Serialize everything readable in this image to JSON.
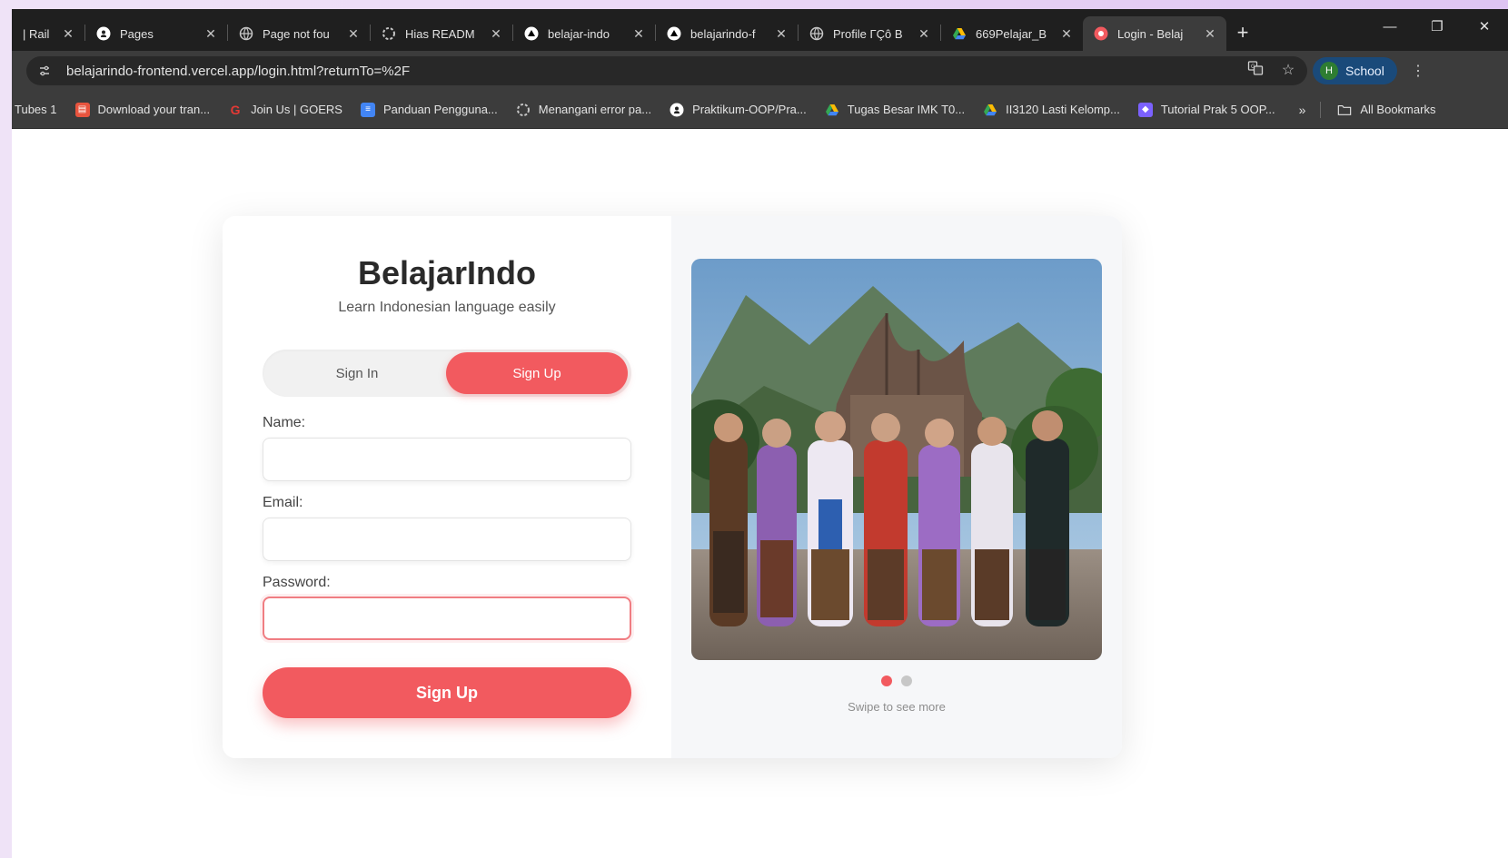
{
  "browser": {
    "tabs": [
      {
        "label": "| Rail",
        "favicon": "rails-icon",
        "color": "#8a8a8a"
      },
      {
        "label": "Pages",
        "favicon": "github-icon",
        "color": "#ffffff"
      },
      {
        "label": "Page not fou",
        "favicon": "globe-icon",
        "color": "#9e9e9e"
      },
      {
        "label": "Hias READM",
        "favicon": "openai-icon",
        "color": "#9e9e9e"
      },
      {
        "label": "belajar-indo",
        "favicon": "vercel-icon",
        "color": "#ffffff"
      },
      {
        "label": "belajarindo-f",
        "favicon": "vercel-icon",
        "color": "#ffffff"
      },
      {
        "label": "Profile ΓÇô B",
        "favicon": "globe-icon",
        "color": "#9e9e9e"
      },
      {
        "label": "669Pelajar_B",
        "favicon": "drive-icon",
        "color": "#34a853"
      },
      {
        "label": "Login - Belaj",
        "favicon": "belajarindo-icon",
        "color": "#f25a5f",
        "active": true
      }
    ],
    "url": "belajarindo-frontend.vercel.app/login.html?returnTo=%2F",
    "profile": {
      "initial": "H",
      "label": "School"
    },
    "bookmarks": [
      {
        "label": "Tubes 1",
        "icon": "",
        "color": ""
      },
      {
        "label": "Download your tran...",
        "icon": "document-icon",
        "color": "#e8543e"
      },
      {
        "label": "Join Us | GOERS",
        "icon": "goers-icon",
        "color": "#e53935"
      },
      {
        "label": "Panduan Pengguna...",
        "icon": "docs-icon",
        "color": "#4285f4"
      },
      {
        "label": "Menangani error pa...",
        "icon": "openai-icon",
        "color": "#9e9e9e"
      },
      {
        "label": "Praktikum-OOP/Pra...",
        "icon": "github-icon",
        "color": "#ffffff"
      },
      {
        "label": "Tugas Besar IMK T0...",
        "icon": "drive-icon",
        "color": "#fbbc04"
      },
      {
        "label": "II3120 Lasti Kelomp...",
        "icon": "drive-icon",
        "color": "#fbbc04"
      },
      {
        "label": "Tutorial Prak 5 OOP...",
        "icon": "shield-icon",
        "color": "#7b61ff"
      }
    ],
    "bookmarks_more": "»",
    "all_bookmarks": "All Bookmarks"
  },
  "auth": {
    "brand": "BelajarIndo",
    "tagline": "Learn Indonesian language easily",
    "toggle": {
      "signin": "Sign In",
      "signup": "Sign Up",
      "active": "signup"
    },
    "fields": {
      "name_label": "Name:",
      "name_value": "",
      "email_label": "Email:",
      "email_value": "",
      "password_label": "Password:",
      "password_value": ""
    },
    "submit": "Sign Up"
  },
  "carousel": {
    "dots": 2,
    "active_index": 0,
    "hint": "Swipe to see more"
  },
  "colors": {
    "accent": "#f25a5f"
  }
}
